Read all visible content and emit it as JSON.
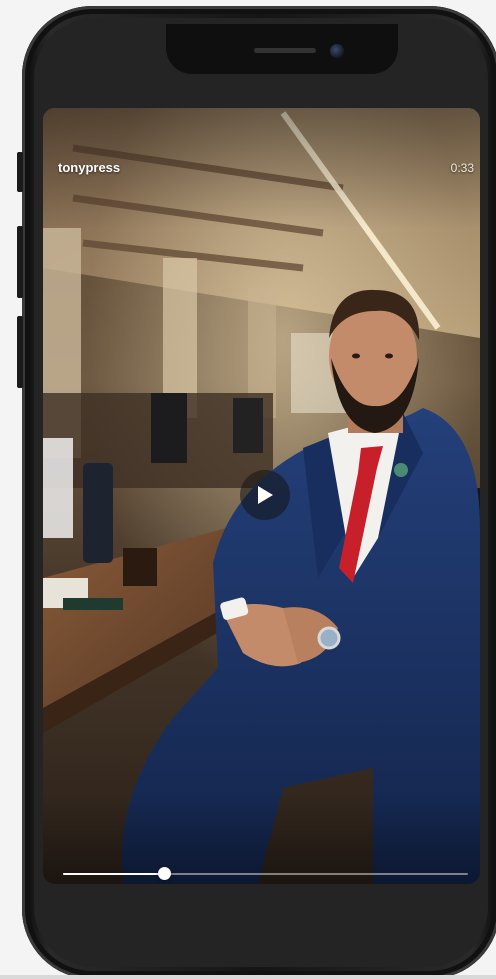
{
  "video": {
    "username": "tonypress",
    "duration": "0:33",
    "progress": 0.25
  },
  "icons": {
    "play": "play-icon"
  },
  "colors": {
    "phone_frame": "#151515",
    "tie": "#c8202a",
    "suit": "#1f3566"
  }
}
